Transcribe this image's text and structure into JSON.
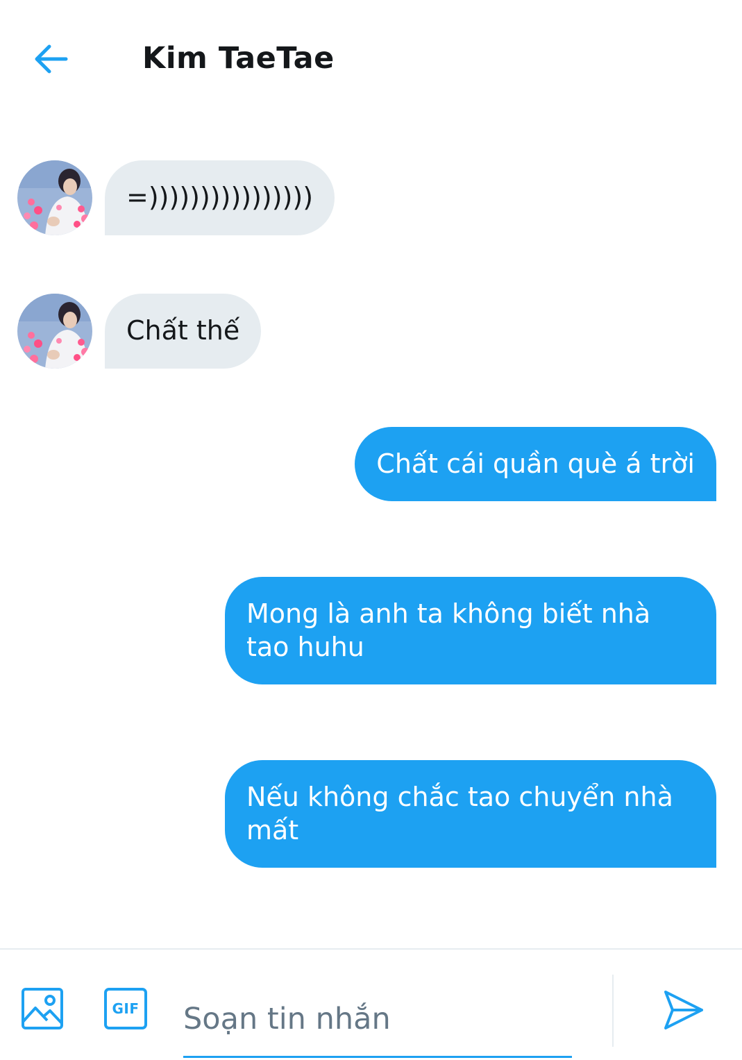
{
  "header": {
    "title": "Kim TaeTae",
    "back_icon": "arrow-left-icon"
  },
  "messages": [
    {
      "direction": "incoming",
      "text": "=))))))))))))))))"
    },
    {
      "direction": "incoming",
      "text": "Chất thế"
    },
    {
      "direction": "outgoing",
      "text": "Chất cái quần què á trời"
    },
    {
      "direction": "outgoing",
      "text": "Mong là anh ta không biết nhà tao huhu"
    },
    {
      "direction": "outgoing",
      "text": "Nếu không chắc tao chuyển nhà mất"
    }
  ],
  "composer": {
    "placeholder": "Soạn tin nhắn",
    "value": "",
    "media_icon": "image-icon",
    "gif_label": "GIF",
    "send_icon": "send-icon"
  },
  "colors": {
    "accent": "#1da1f2",
    "incoming_bubble": "#e6ecf0",
    "text_primary": "#14171a",
    "text_secondary": "#657786"
  }
}
